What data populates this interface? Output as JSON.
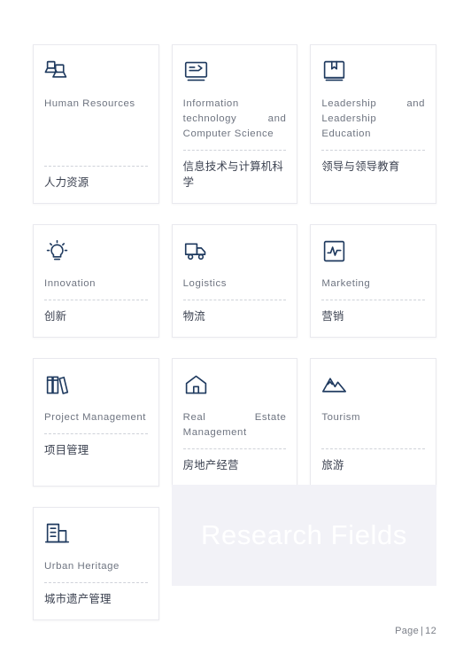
{
  "document": {
    "footer_label": "Page",
    "footer_separator": "|",
    "footer_page_number": "12"
  },
  "banner": {
    "title": "Research Fields",
    "background_color": "#f2f2f7",
    "text_color": "#ffffff"
  },
  "theme": {
    "icon_color": "#1f3a5f",
    "english_text_color": "#6e7480",
    "chinese_text_color": "#3b4150",
    "card_border_color": "#e9e9ee",
    "divider_color": "#cfd2d9",
    "page_background": "#ffffff"
  },
  "cards": [
    {
      "icon": "users-group-icon",
      "en": "Human Resources",
      "zh": "人力资源"
    },
    {
      "icon": "computer-monitor-icon",
      "en": "Information technology and Computer Science",
      "zh": "信息技术与计算机科学"
    },
    {
      "icon": "book-bookmark-icon",
      "en": "Leadership and Leadership Education",
      "zh": "领导与领导教育"
    },
    {
      "icon": "lightbulb-icon",
      "en": "Innovation",
      "zh": "创新"
    },
    {
      "icon": "delivery-truck-icon",
      "en": "Logistics",
      "zh": "物流"
    },
    {
      "icon": "pulse-chart-icon",
      "en": "Marketing",
      "zh": "营销"
    },
    {
      "icon": "books-shelf-icon",
      "en": "Project Management",
      "zh": "项目管理"
    },
    {
      "icon": "house-icon",
      "en": "Real Estate Management",
      "zh": "房地产经营"
    },
    {
      "icon": "mountain-icon",
      "en": "Tourism",
      "zh": "旅游"
    },
    {
      "icon": "office-building-icon",
      "en": "Urban Heritage",
      "zh": "城市遗产管理"
    }
  ]
}
